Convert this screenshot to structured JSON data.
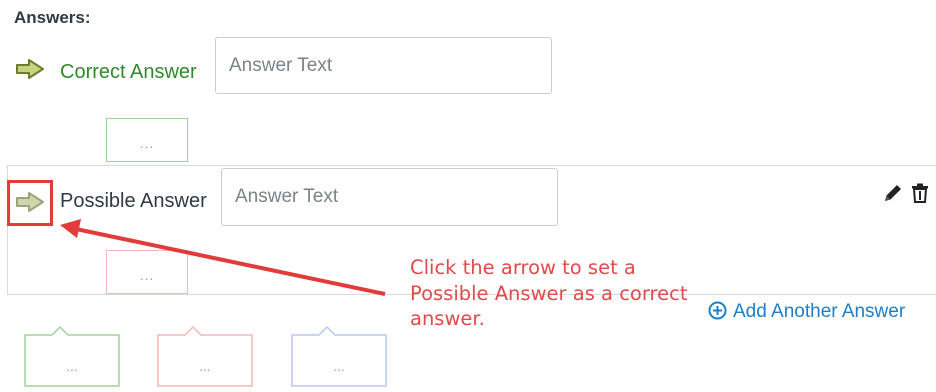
{
  "answers_heading": "Answers:",
  "correct_answer": {
    "label": "Correct Answer",
    "input_placeholder": "Answer Text",
    "input_value": "",
    "comment_dots": "..."
  },
  "possible_answer": {
    "label": "Possible Answer",
    "input_placeholder": "Answer Text",
    "input_value": "",
    "comment_dots": "..."
  },
  "comment_bubbles": [
    {
      "dots": "...",
      "color": "#9fd49a"
    },
    {
      "dots": "...",
      "color": "#f4b6b6"
    },
    {
      "dots": "...",
      "color": "#b9c7ee"
    }
  ],
  "callout": {
    "text": "Click the arrow to set a Possible Answer as a correct answer.",
    "color": "#e24a4a"
  },
  "add_answer_label": "Add Another Answer",
  "icons": {
    "set_correct_arrow": "arrow-right-icon",
    "edit": "pencil-icon",
    "delete": "trash-icon",
    "add": "plus-circle-icon"
  },
  "colors": {
    "correct": "#2f8a2b",
    "link": "#1d7fc9",
    "annotation": "#e23b3b"
  }
}
